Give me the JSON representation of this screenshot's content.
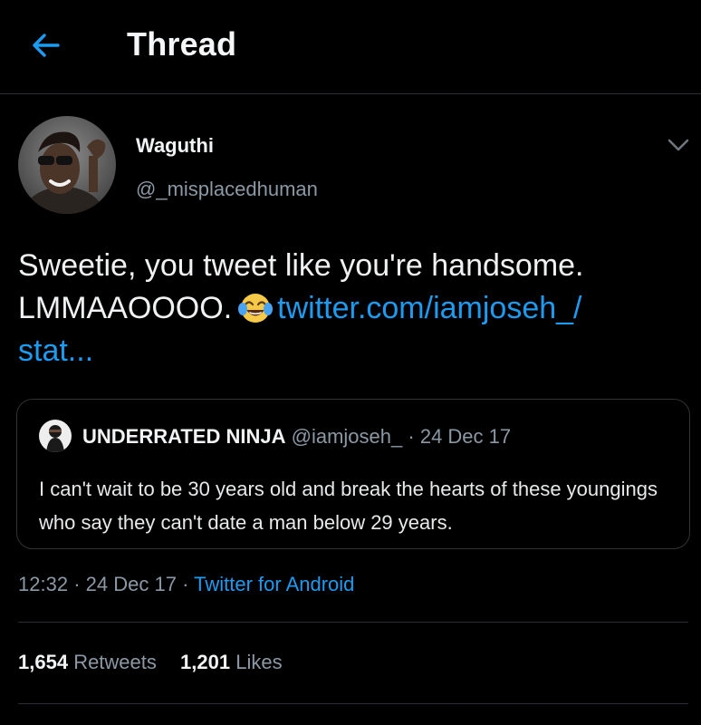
{
  "header": {
    "back_icon": "arrow-left-icon",
    "title": "Thread",
    "accent_color": "#1d9bf0"
  },
  "tweet": {
    "author_name": "Waguthi",
    "author_handle": "@_misplacedhuman",
    "text_line1": "Sweetie, you tweet like you're handsome.",
    "text_line2_prefix": "LMMAAOOOO.",
    "emoji": "face-with-tears-of-joy-icon",
    "link_part1": "twitter.com/iamjoseh_/",
    "link_part2": "stat...",
    "timestamp": "12:32",
    "date": "24 Dec 17",
    "source": "Twitter for Android",
    "retweets_count": "1,654",
    "retweets_label": "Retweets",
    "likes_count": "1,201",
    "likes_label": "Likes"
  },
  "quoted_tweet": {
    "author_name": "UNDERRATED NINJA",
    "author_handle": "@iamjoseh_",
    "date": "24 Dec 17",
    "text": "I can't wait to be 30 years old and break the hearts of these youngings who say they can't date a man below 29 years."
  }
}
